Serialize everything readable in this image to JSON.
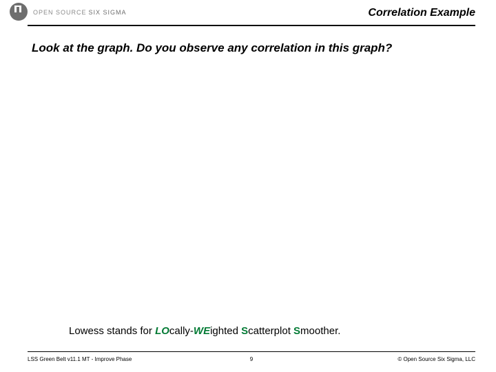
{
  "logo": {
    "word1": "OPEN SOURCE",
    "word2": "SIX SIGMA"
  },
  "header": {
    "title": "Correlation Example"
  },
  "question": "Look at the graph.  Do you observe any correlation in this graph?",
  "lowess": {
    "prefix": "Lowess stands for ",
    "lo": "LO",
    "cally": "cally-",
    "we": "WE",
    "ighted": "ighted ",
    "s1": "S",
    "catterplot": "catterplot ",
    "s2": "S",
    "moother": "moother."
  },
  "footer": {
    "left": "LSS Green Belt v11.1 MT - Improve Phase",
    "center": "9",
    "right": "© Open Source Six Sigma, LLC"
  }
}
